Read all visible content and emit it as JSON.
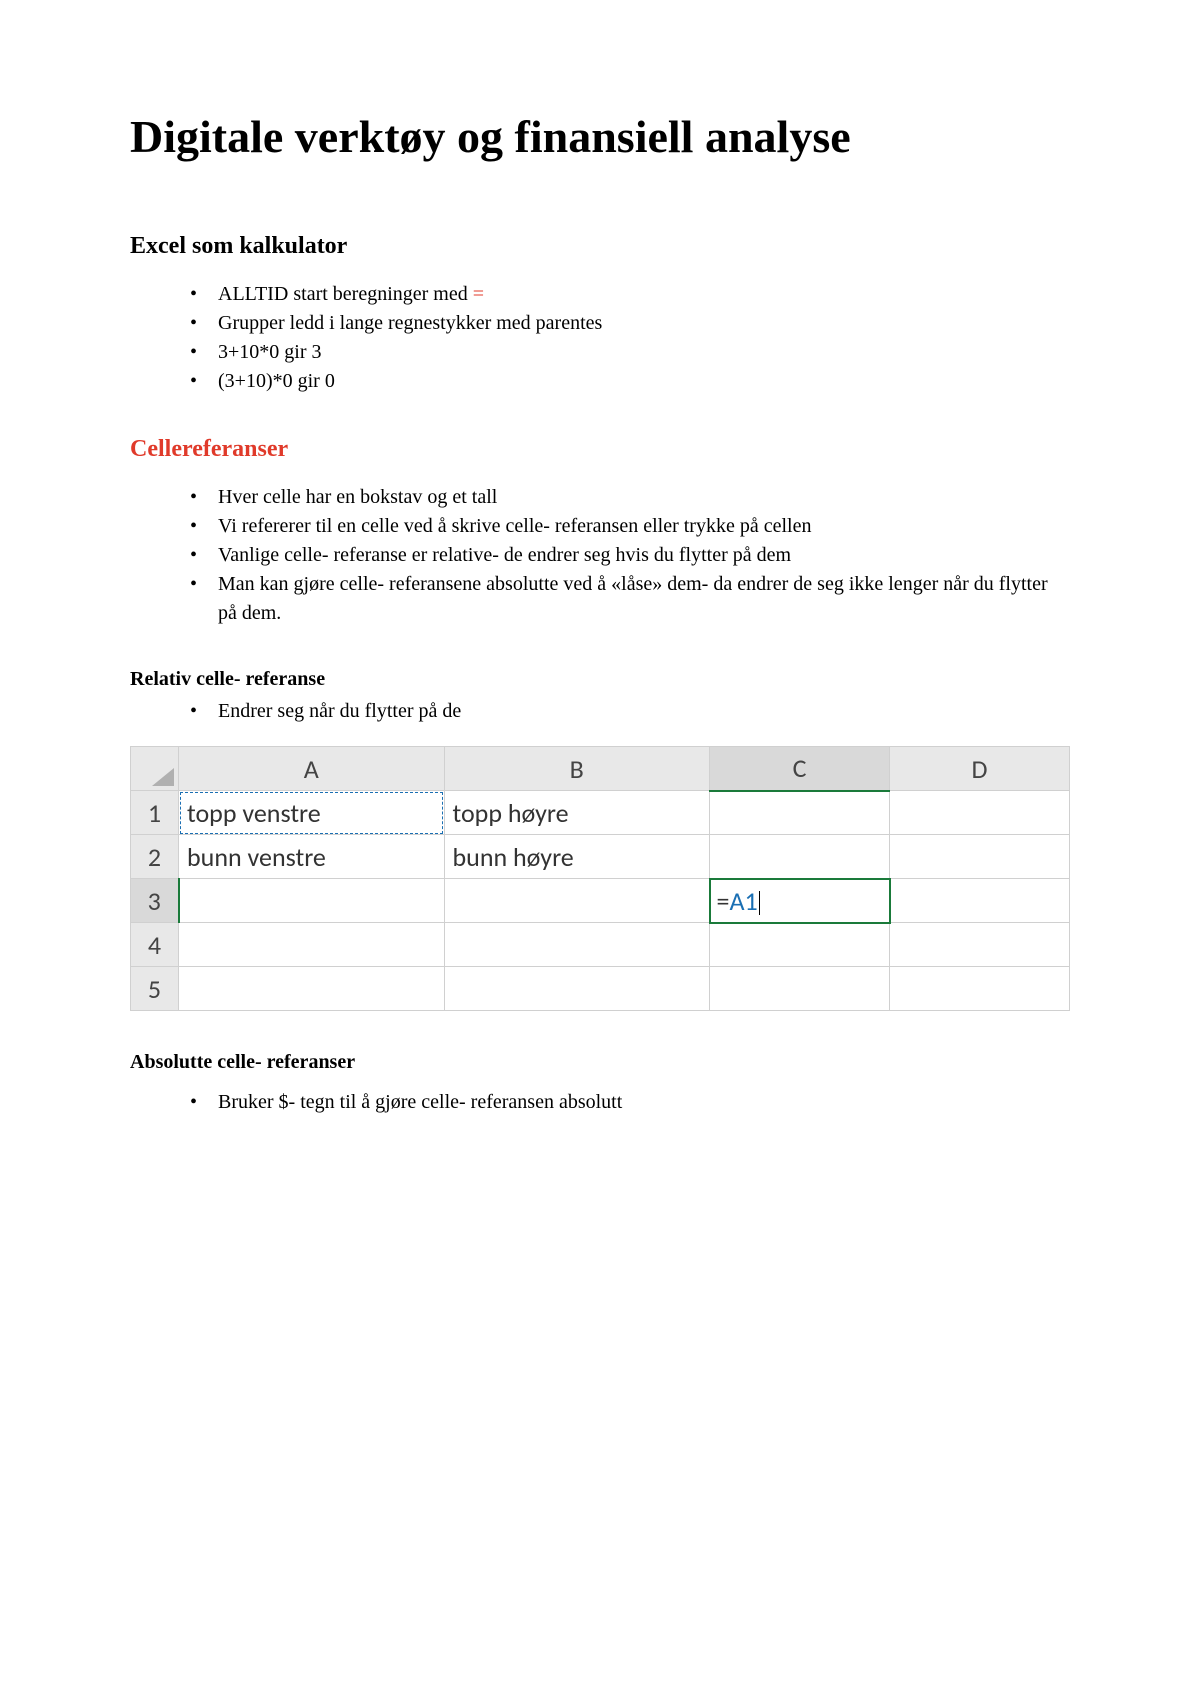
{
  "title": "Digitale verktøy og finansiell analyse",
  "section1": {
    "heading": "Excel som kalkulator",
    "bullets": [
      {
        "text": "ALLTID start beregninger med ",
        "suffix": "="
      },
      {
        "text": "Grupper ledd i lange regnestykker med parentes"
      },
      {
        "text": "3+10*0 gir 3"
      },
      {
        "text": "(3+10)*0 gir 0"
      }
    ]
  },
  "section2": {
    "heading": "Cellereferanser",
    "bullets": [
      "Hver celle har en bokstav og et tall",
      "Vi refererer til en celle ved å skrive celle- referansen eller trykke på cellen",
      "Vanlige celle- referanse er relative- de endrer seg hvis du flytter på dem",
      "Man kan gjøre celle- referansene absolutte ved å «låse» dem- da endrer de seg ikke lenger når du flytter på dem."
    ]
  },
  "relative": {
    "heading": "Relativ celle- referanse",
    "bullet": "Endrer seg når du flytter på de"
  },
  "sheet": {
    "cols": [
      "A",
      "B",
      "C",
      "D"
    ],
    "rows": [
      "1",
      "2",
      "3",
      "4",
      "5"
    ],
    "cells": {
      "A1": "topp venstre",
      "B1": "topp høyre",
      "A2": "bunn venstre",
      "B2": "bunn høyre"
    },
    "formula_prefix": "=",
    "formula_ref": "A1"
  },
  "absolute": {
    "heading": "Absolutte celle- referanser",
    "bullet": "Bruker $- tegn til å gjøre celle- referansen absolutt"
  }
}
